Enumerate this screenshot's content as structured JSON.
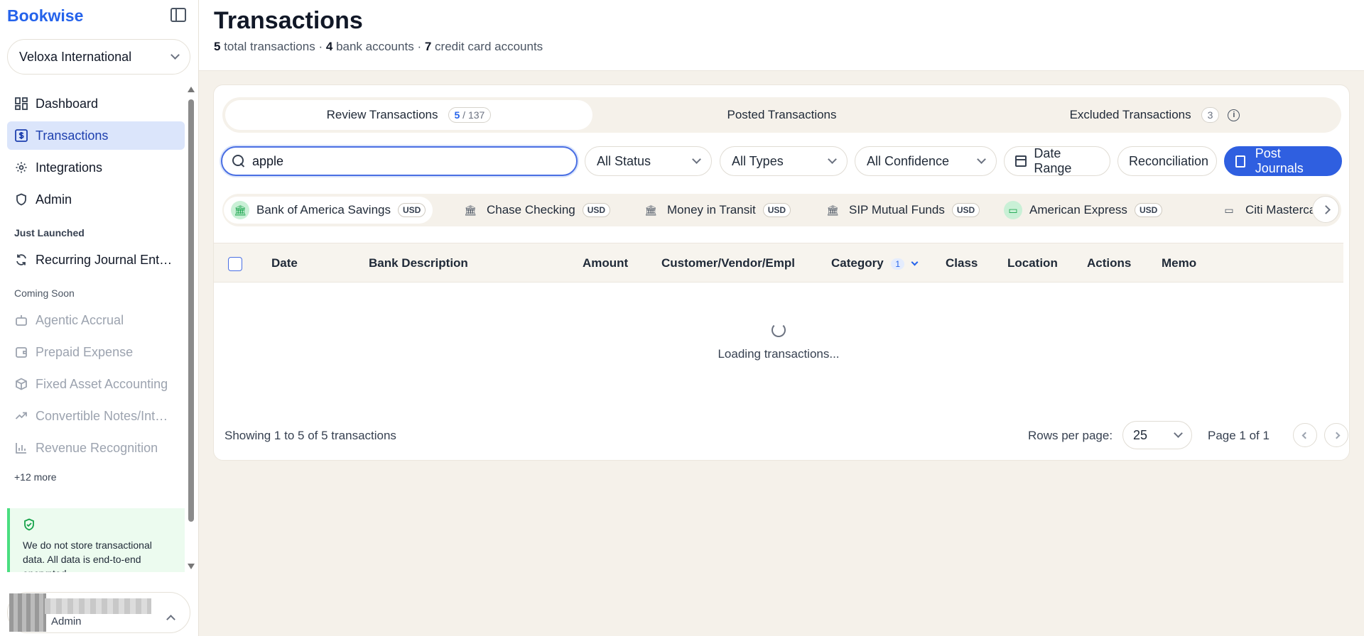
{
  "sidebar": {
    "brand": "Bookwise",
    "org": "Veloxa International",
    "main_nav": [
      {
        "label": "Dashboard",
        "icon": "dashboard-icon"
      },
      {
        "label": "Transactions",
        "icon": "dollar-icon",
        "active": true
      },
      {
        "label": "Integrations",
        "icon": "gear-icon"
      },
      {
        "label": "Admin",
        "icon": "shield-icon"
      }
    ],
    "just_launched_title": "Just Launched",
    "just_launched": [
      {
        "label": "Recurring Journal Ent…",
        "icon": "refresh-icon"
      }
    ],
    "coming_soon_title": "Coming Soon",
    "coming_soon": [
      {
        "label": "Agentic Accrual",
        "icon": "robot-icon"
      },
      {
        "label": "Prepaid Expense",
        "icon": "wallet-icon"
      },
      {
        "label": "Fixed Asset Accounting",
        "icon": "box-icon"
      },
      {
        "label": "Convertible Notes/Int…",
        "icon": "trend-up-icon"
      },
      {
        "label": "Revenue Recognition",
        "icon": "bar-chart-icon"
      }
    ],
    "more": "+12 more",
    "notice": "We do not store transactional data. All data is end-to-end encrypted.",
    "user_role": "Admin"
  },
  "header": {
    "title": "Transactions",
    "total_count": "5",
    "total_label": "total transactions",
    "bank_count": "4",
    "bank_label": "bank accounts",
    "cc_count": "7",
    "cc_label": "credit card accounts",
    "separator": "·"
  },
  "tabs": [
    {
      "label": "Review Transactions",
      "count_a": "5",
      "count_b": "137",
      "active": true
    },
    {
      "label": "Posted Transactions"
    },
    {
      "label": "Excluded Transactions",
      "count": "3"
    }
  ],
  "filters": {
    "search_value": "apple",
    "status": "All Status",
    "types": "All Types",
    "confidence": "All Confidence",
    "date_range": "Date Range",
    "reconciliation": "Reconciliation",
    "post_journals": "Post Journals"
  },
  "accounts": [
    {
      "name": "Bank of America Savings",
      "currency": "USD",
      "icon": "bank-icon"
    },
    {
      "name": "Chase Checking",
      "currency": "USD",
      "icon": "bank-icon"
    },
    {
      "name": "Money in Transit",
      "currency": "USD",
      "icon": "bank-icon"
    },
    {
      "name": "SIP Mutual Funds",
      "currency": "USD",
      "icon": "bank-icon"
    },
    {
      "name": "American Express",
      "currency": "USD",
      "icon": "credit-card-icon"
    },
    {
      "name": "Citi Mastercard",
      "icon": "credit-card-icon"
    }
  ],
  "table": {
    "columns": [
      "Date",
      "Bank Description",
      "Amount",
      "Customer/Vendor/Empl",
      "Category",
      "Class",
      "Location",
      "Actions",
      "Memo"
    ],
    "category_filter_count": "1",
    "loading_text": "Loading transactions..."
  },
  "pagination": {
    "showing": "Showing 1 to 5 of 5 transactions",
    "rows_label": "Rows per page:",
    "rows_value": "25",
    "page_info": "Page 1 of 1"
  },
  "colors": {
    "accent": "#2563eb",
    "primary_button": "#2f5fe0",
    "active_nav_bg": "#dbe5fb",
    "page_bg": "#f5f1ea",
    "notice_bg": "#ecfbef"
  }
}
